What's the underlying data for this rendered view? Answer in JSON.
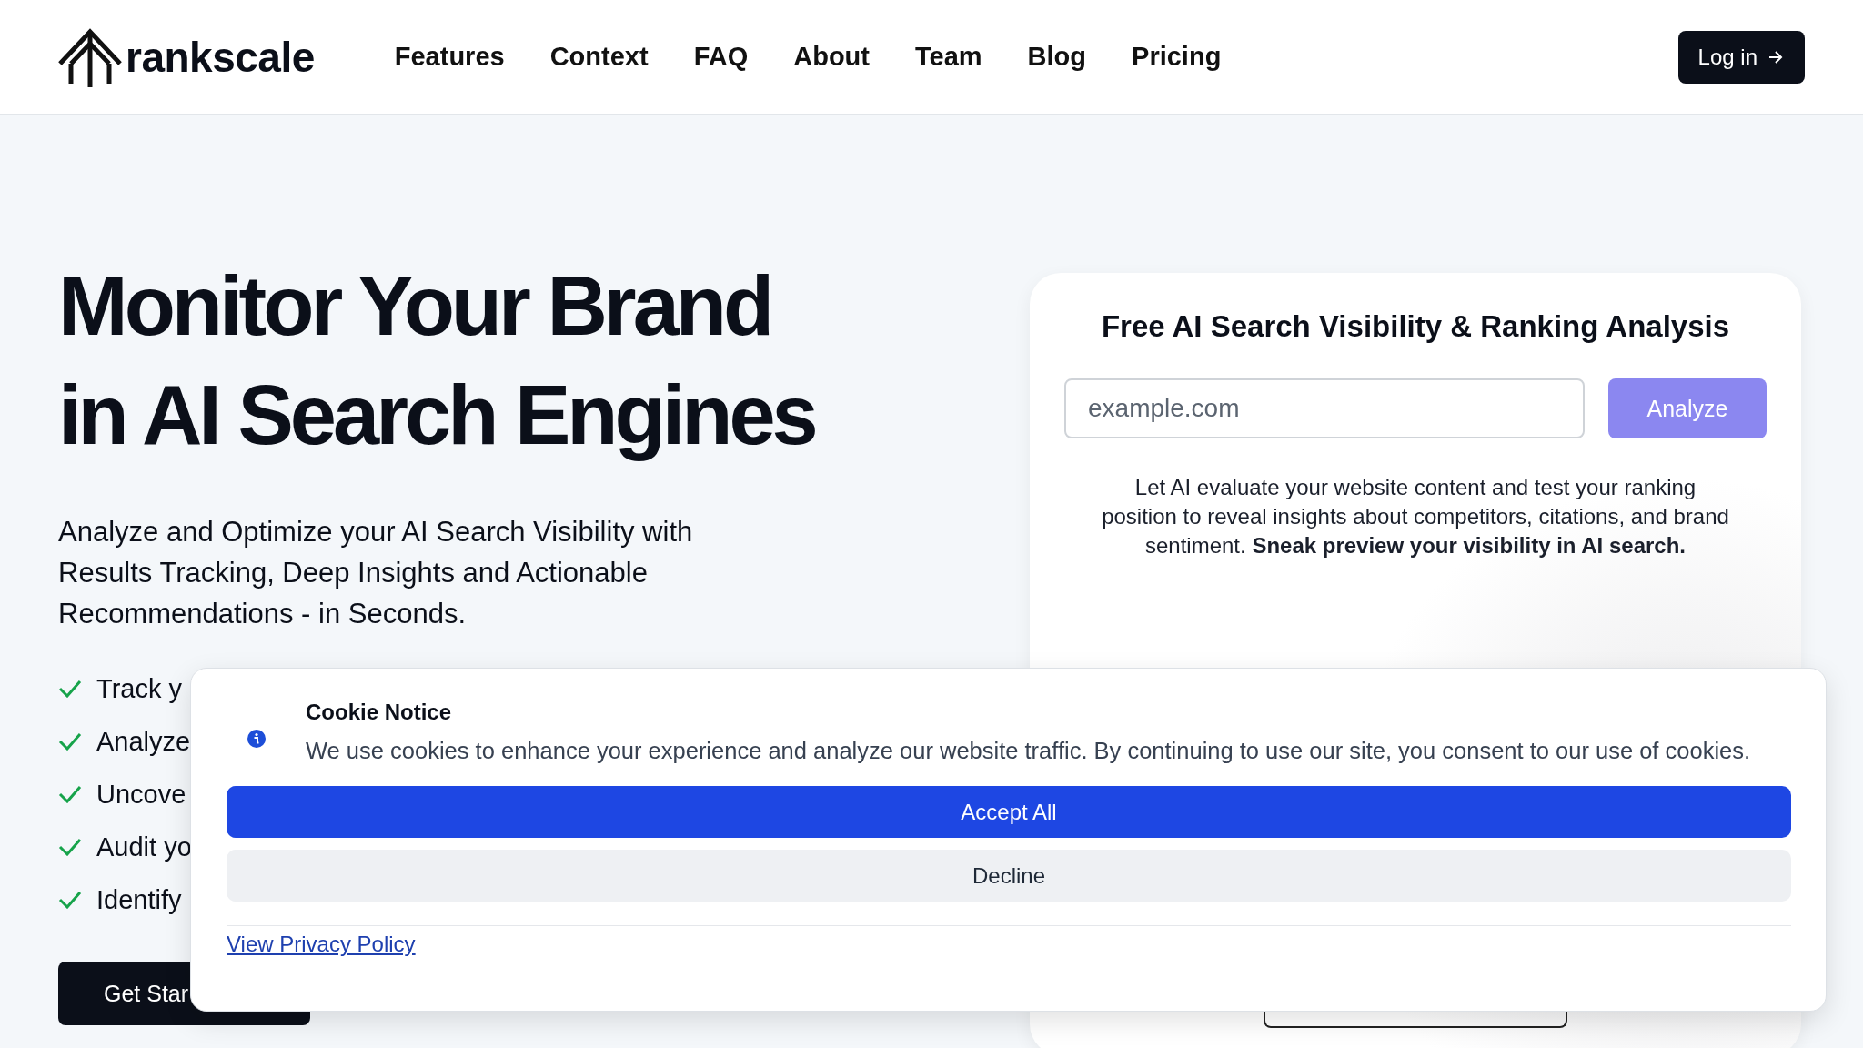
{
  "header": {
    "logo": "rankscale",
    "nav": [
      {
        "label": "Features"
      },
      {
        "label": "Context"
      },
      {
        "label": "FAQ"
      },
      {
        "label": "About"
      },
      {
        "label": "Team"
      },
      {
        "label": "Blog"
      },
      {
        "label": "Pricing"
      }
    ],
    "login": "Log in"
  },
  "hero": {
    "title_lines": [
      "Monitor Your Brand",
      "in AI Search Engines"
    ],
    "subtitle": "Analyze and Optimize your AI Search Visibility with Results Tracking, Deep Insights and Actionable Recommendations - in Seconds.",
    "features": [
      "Track y",
      "Analyze",
      "Uncove",
      "Audit yo",
      "Identify"
    ],
    "cta": "Get Star"
  },
  "analysis_card": {
    "title": "Free AI Search Visibility & Ranking Analysis",
    "input": {
      "placeholder": "example.com"
    },
    "button": "Analyze",
    "description": "Let AI evaluate your website content and test your ranking position to reveal insights about competitors, citations, and brand sentiment. **Sneak preview your visibility in AI search.**"
  },
  "cookie_notice": {
    "title": "Cookie Notice",
    "message": "We use cookies to enhance your experience and analyze our website traffic. By continuing to use our site, you consent to our use of cookies.",
    "accept": "Accept All",
    "decline": "Decline",
    "privacy_link": "View Privacy Policy"
  }
}
